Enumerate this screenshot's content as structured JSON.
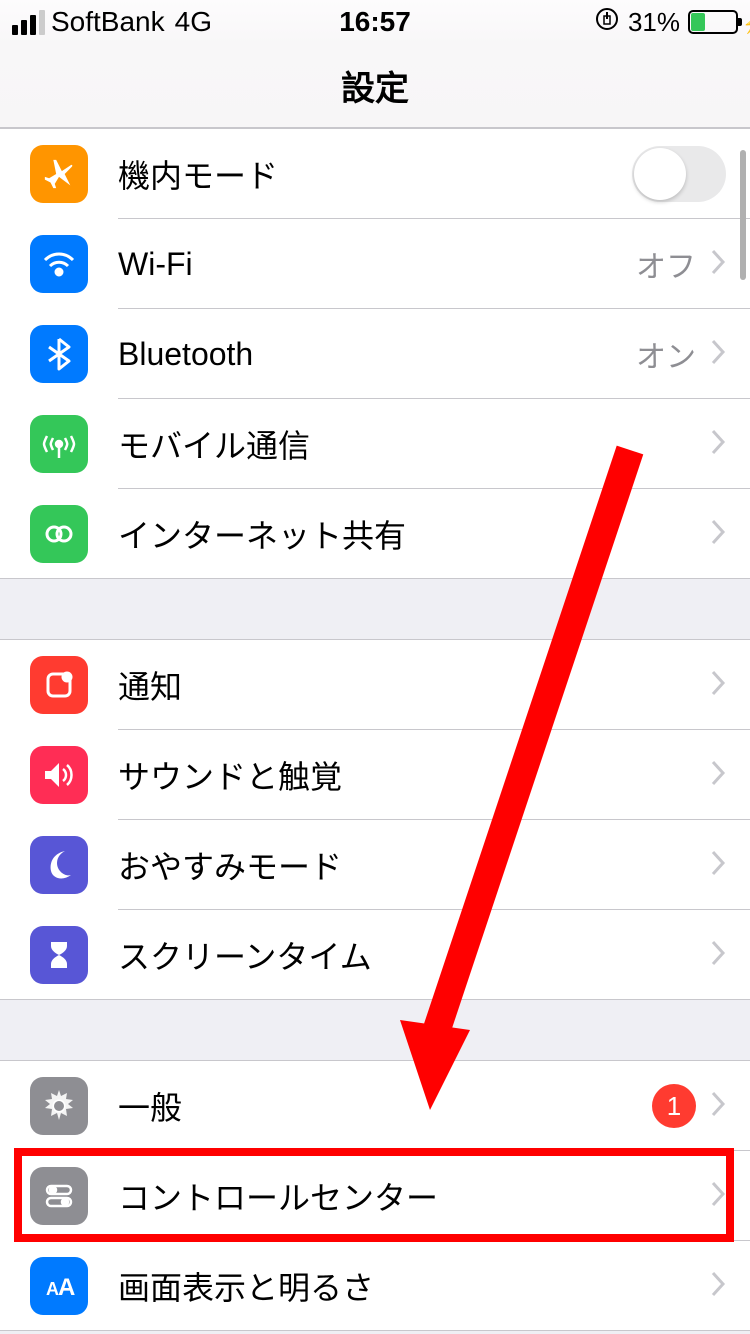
{
  "status": {
    "carrier": "SoftBank",
    "network": "4G",
    "time": "16:57",
    "battery_pct": "31%",
    "lock_rotation_glyph": "⟳"
  },
  "nav": {
    "title": "設定"
  },
  "group1": {
    "airplane": {
      "label": "機内モード",
      "switch_on": false
    },
    "wifi": {
      "label": "Wi-Fi",
      "value": "オフ"
    },
    "bluetooth": {
      "label": "Bluetooth",
      "value": "オン"
    },
    "cellular": {
      "label": "モバイル通信"
    },
    "hotspot": {
      "label": "インターネット共有"
    }
  },
  "group2": {
    "notifications": {
      "label": "通知"
    },
    "sounds": {
      "label": "サウンドと触覚"
    },
    "dnd": {
      "label": "おやすみモード"
    },
    "screentime": {
      "label": "スクリーンタイム"
    }
  },
  "group3": {
    "general": {
      "label": "一般",
      "badge": "1"
    },
    "controlcenter": {
      "label": "コントロールセンター"
    },
    "display": {
      "label": "画面表示と明るさ"
    }
  }
}
